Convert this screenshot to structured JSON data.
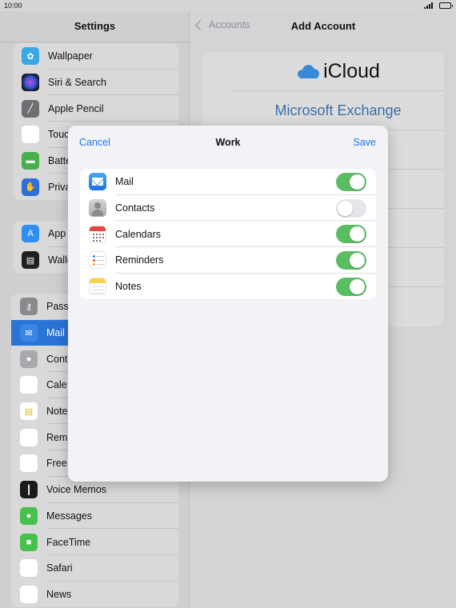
{
  "status_bar": {
    "time": "10:00"
  },
  "left_pane": {
    "title": "Settings",
    "groups": [
      {
        "items": [
          {
            "label": "Wallpaper",
            "icon": "wallpaper-icon"
          },
          {
            "label": "Siri & Search",
            "icon": "siri-icon"
          },
          {
            "label": "Apple Pencil",
            "icon": "pencil-icon"
          },
          {
            "label": "Touc",
            "icon": "fingerprint-icon"
          },
          {
            "label": "Batte",
            "icon": "battery-icon"
          },
          {
            "label": "Priva",
            "icon": "hand-icon"
          }
        ]
      },
      {
        "items": [
          {
            "label": "App",
            "icon": "app-store-icon"
          },
          {
            "label": "Walle",
            "icon": "wallet-icon"
          }
        ]
      },
      {
        "items": [
          {
            "label": "Pass",
            "icon": "key-icon"
          },
          {
            "label": "Mail",
            "icon": "mail-icon",
            "selected": true
          },
          {
            "label": "Cont",
            "icon": "contacts-icon"
          },
          {
            "label": "Cale",
            "icon": "calendar-icon"
          },
          {
            "label": "Note",
            "icon": "notes-icon"
          },
          {
            "label": "Rem",
            "icon": "reminders-icon"
          },
          {
            "label": "Free",
            "icon": "freeform-icon"
          },
          {
            "label": "Voice Memos",
            "icon": "voice-memos-icon"
          },
          {
            "label": "Messages",
            "icon": "messages-icon"
          },
          {
            "label": "FaceTime",
            "icon": "facetime-icon"
          },
          {
            "label": "Safari",
            "icon": "safari-icon"
          },
          {
            "label": "News",
            "icon": "news-icon"
          }
        ]
      }
    ]
  },
  "right_pane": {
    "back_label": "Accounts",
    "title": "Add Account",
    "providers": [
      {
        "label": "iCloud"
      },
      {
        "label": "Microsoft Exchange"
      }
    ]
  },
  "sheet": {
    "cancel_label": "Cancel",
    "title": "Work",
    "save_label": "Save",
    "toggles": [
      {
        "label": "Mail",
        "on": true,
        "icon": "mail-icon"
      },
      {
        "label": "Contacts",
        "on": false,
        "icon": "contacts-icon"
      },
      {
        "label": "Calendars",
        "on": true,
        "icon": "calendar-icon"
      },
      {
        "label": "Reminders",
        "on": true,
        "icon": "reminders-icon"
      },
      {
        "label": "Notes",
        "on": true,
        "icon": "notes-icon"
      }
    ]
  },
  "colors": {
    "accent": "#1a7ae0",
    "toggle_on": "#5bbd63",
    "toggle_off": "#e6e6ea",
    "selected_row": "#2b73d6"
  }
}
